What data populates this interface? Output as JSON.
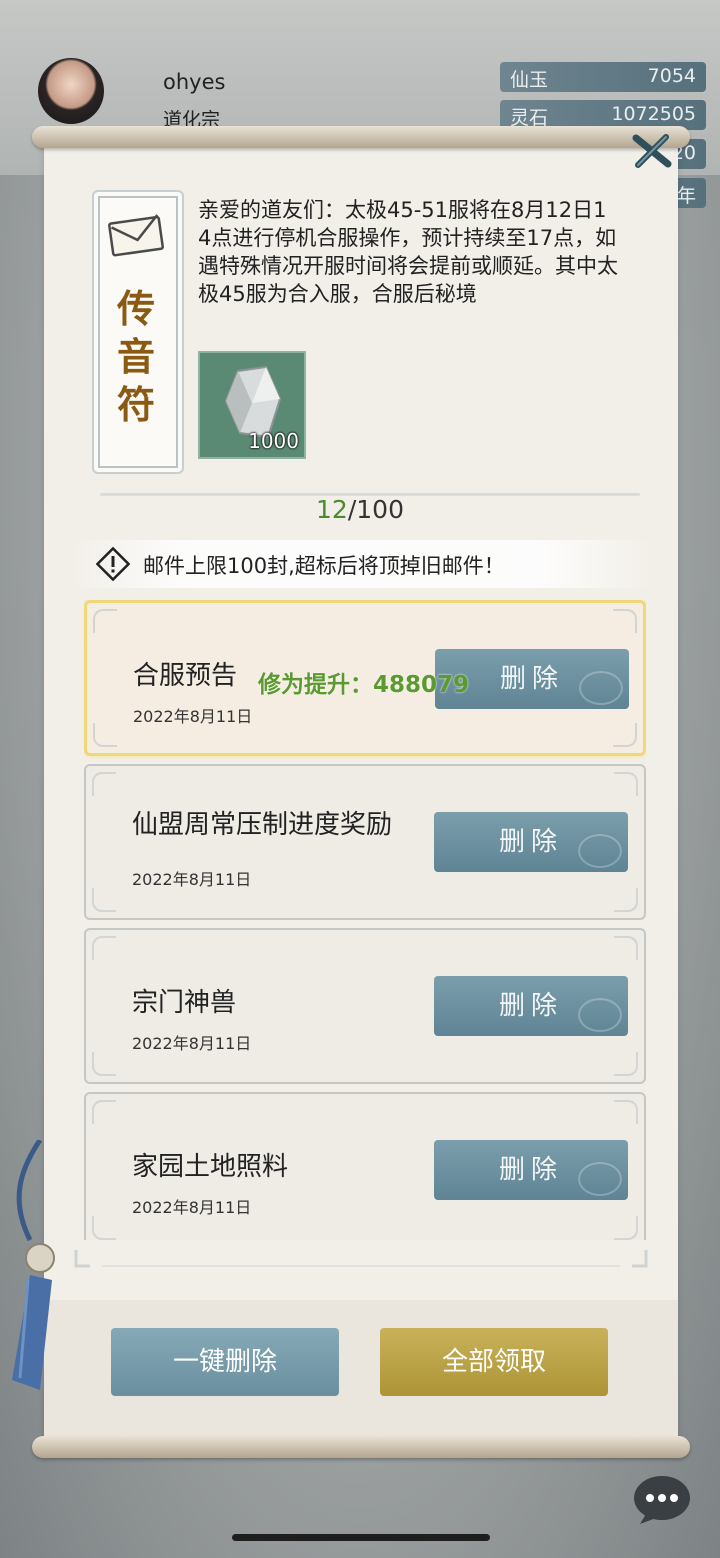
{
  "hud": {
    "player_name": "ohyes",
    "sect_name": "道化宗",
    "resources": [
      {
        "label": "仙玉",
        "value": "7054"
      },
      {
        "label": "灵石",
        "value": "1072505"
      },
      {
        "label": "",
        "value": "20"
      },
      {
        "label": "",
        "value": "年"
      }
    ]
  },
  "panel": {
    "side_title_chars": [
      "传",
      "音",
      "符"
    ],
    "notice_text": "亲爱的道友们：太极45-51服将在8月12日14点进行停机合服操作，预计持续至17点，如遇特殊情况开服时间将会提前或顺延。其中太极45服为合入服，合服后秘境",
    "attachment_count": "1000",
    "mail_count_current": "12",
    "mail_count_total": "/100",
    "warning_text": "邮件上限100封,超标后将顶掉旧邮件！"
  },
  "mails": [
    {
      "title": "合服预告",
      "date": "2022年8月11日",
      "delete_label": "删除",
      "selected": true
    },
    {
      "title": "仙盟周常压制进度奖励",
      "date": "2022年8月11日",
      "delete_label": "删除",
      "selected": false
    },
    {
      "title": "宗门神兽",
      "date": "2022年8月11日",
      "delete_label": "删除",
      "selected": false
    },
    {
      "title": "家园土地照料",
      "date": "2022年8月11日",
      "delete_label": "删除",
      "selected": false
    }
  ],
  "float_text": "修为提升：488079",
  "buttons": {
    "delete_all": "一键删除",
    "claim_all": "全部领取"
  },
  "colors": {
    "accent_green": "#4c8a2e",
    "delete_button": "#6a8f9e",
    "claim_button": "#ad9436",
    "selected_border": "#f0d77a"
  }
}
